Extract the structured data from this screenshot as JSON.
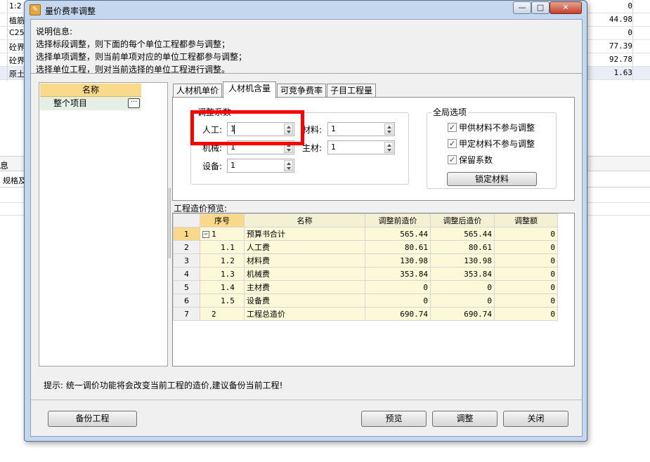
{
  "background_app": {
    "left_cells": [
      "1:2",
      "植筋",
      "C254",
      "砼界",
      "砼界",
      "原土"
    ],
    "right_values": [
      "0",
      "44.98",
      "0",
      "77.39",
      "92.78",
      "1.63"
    ],
    "side_labels": [
      "息",
      "规格及"
    ]
  },
  "dialog": {
    "title": "量价费率调整",
    "title_icon": "app-icon",
    "window_buttons": {
      "minimize": "—",
      "maximize": "□",
      "close": "✕"
    },
    "info": {
      "heading": "说明信息:",
      "lines": [
        "选择标段调整，则下面的每个单位工程都参与调整；",
        "选择单项调整，则当前单项对应的单位工程都参与调整；",
        "选择单位工程，则对当前选择的单位工程进行调整。"
      ]
    },
    "tree": {
      "header": "名称",
      "item": "整个项目",
      "more_button": "···"
    },
    "tabs": [
      "人材机单价",
      "人材机含量",
      "可竞争费率",
      "子目工程量"
    ],
    "active_tab": 1,
    "adjust_group": {
      "title": "调整系数",
      "labor_label": "人工:",
      "labor_value": "1",
      "material_label": "材料:",
      "material_value": "1",
      "machine_label": "机械:",
      "machine_value": "1",
      "main_material_label": "主材:",
      "main_material_value": "1",
      "equipment_label": "设备:",
      "equipment_value": "1"
    },
    "global_group": {
      "title": "全局选项",
      "options": [
        {
          "label": "甲供材料不参与调整",
          "checked": true
        },
        {
          "label": "甲定材料不参与调整",
          "checked": true
        },
        {
          "label": "保留系数",
          "checked": true
        }
      ],
      "lock_button": "锁定材料"
    },
    "preview": {
      "label": "工程造价预览:",
      "columns": [
        "序号",
        "名称",
        "调整前造价",
        "调整后造价",
        "调整额"
      ],
      "rows": [
        {
          "row": "1",
          "seq": "1",
          "name": "预算书合计",
          "before": "565.44",
          "after": "565.44",
          "diff": "0"
        },
        {
          "row": "2",
          "seq": "1.1",
          "name": "人工费",
          "before": "80.61",
          "after": "80.61",
          "diff": "0"
        },
        {
          "row": "3",
          "seq": "1.2",
          "name": "材料费",
          "before": "130.98",
          "after": "130.98",
          "diff": "0"
        },
        {
          "row": "4",
          "seq": "1.3",
          "name": "机械费",
          "before": "353.84",
          "after": "353.84",
          "diff": "0"
        },
        {
          "row": "5",
          "seq": "1.4",
          "name": "主材费",
          "before": "0",
          "after": "0",
          "diff": "0"
        },
        {
          "row": "6",
          "seq": "1.5",
          "name": "设备费",
          "before": "0",
          "after": "0",
          "diff": "0"
        },
        {
          "row": "7",
          "seq": "2",
          "name": "工程总造价",
          "before": "690.74",
          "after": "690.74",
          "diff": "0"
        }
      ]
    },
    "hint": "提示: 统一调价功能将会改变当前工程的造价,建议备份当前工程!",
    "buttons": {
      "backup": "备份工程",
      "preview": "预览",
      "adjust": "调整",
      "close": "关闭"
    },
    "colors": {
      "highlight": "#ff0000",
      "header_yellow": "#f9d98a",
      "cell_yellow": "#fcf8d8",
      "window_frame": "#c4d7ee"
    }
  }
}
